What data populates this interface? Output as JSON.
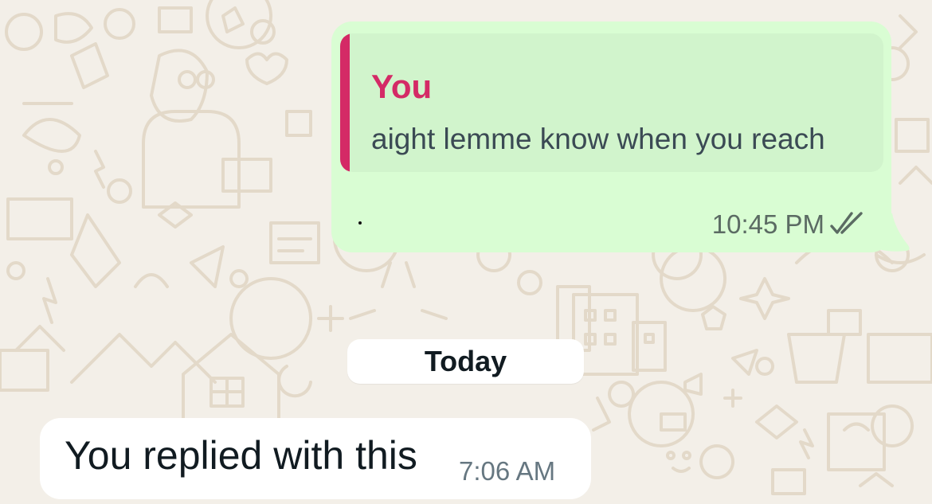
{
  "conversation": {
    "outgoing": {
      "quote_author": "You",
      "quote_text": "aight lemme know when you reach",
      "time": "10:45 PM",
      "status_icon": "double-check-icon"
    },
    "date_separator": "Today",
    "incoming": {
      "text": "You replied with this",
      "time": "7:06 AM"
    }
  },
  "colors": {
    "outgoing_bubble": "#d9fdd3",
    "quote_accent": "#d42a66",
    "background": "#f3efe8"
  }
}
